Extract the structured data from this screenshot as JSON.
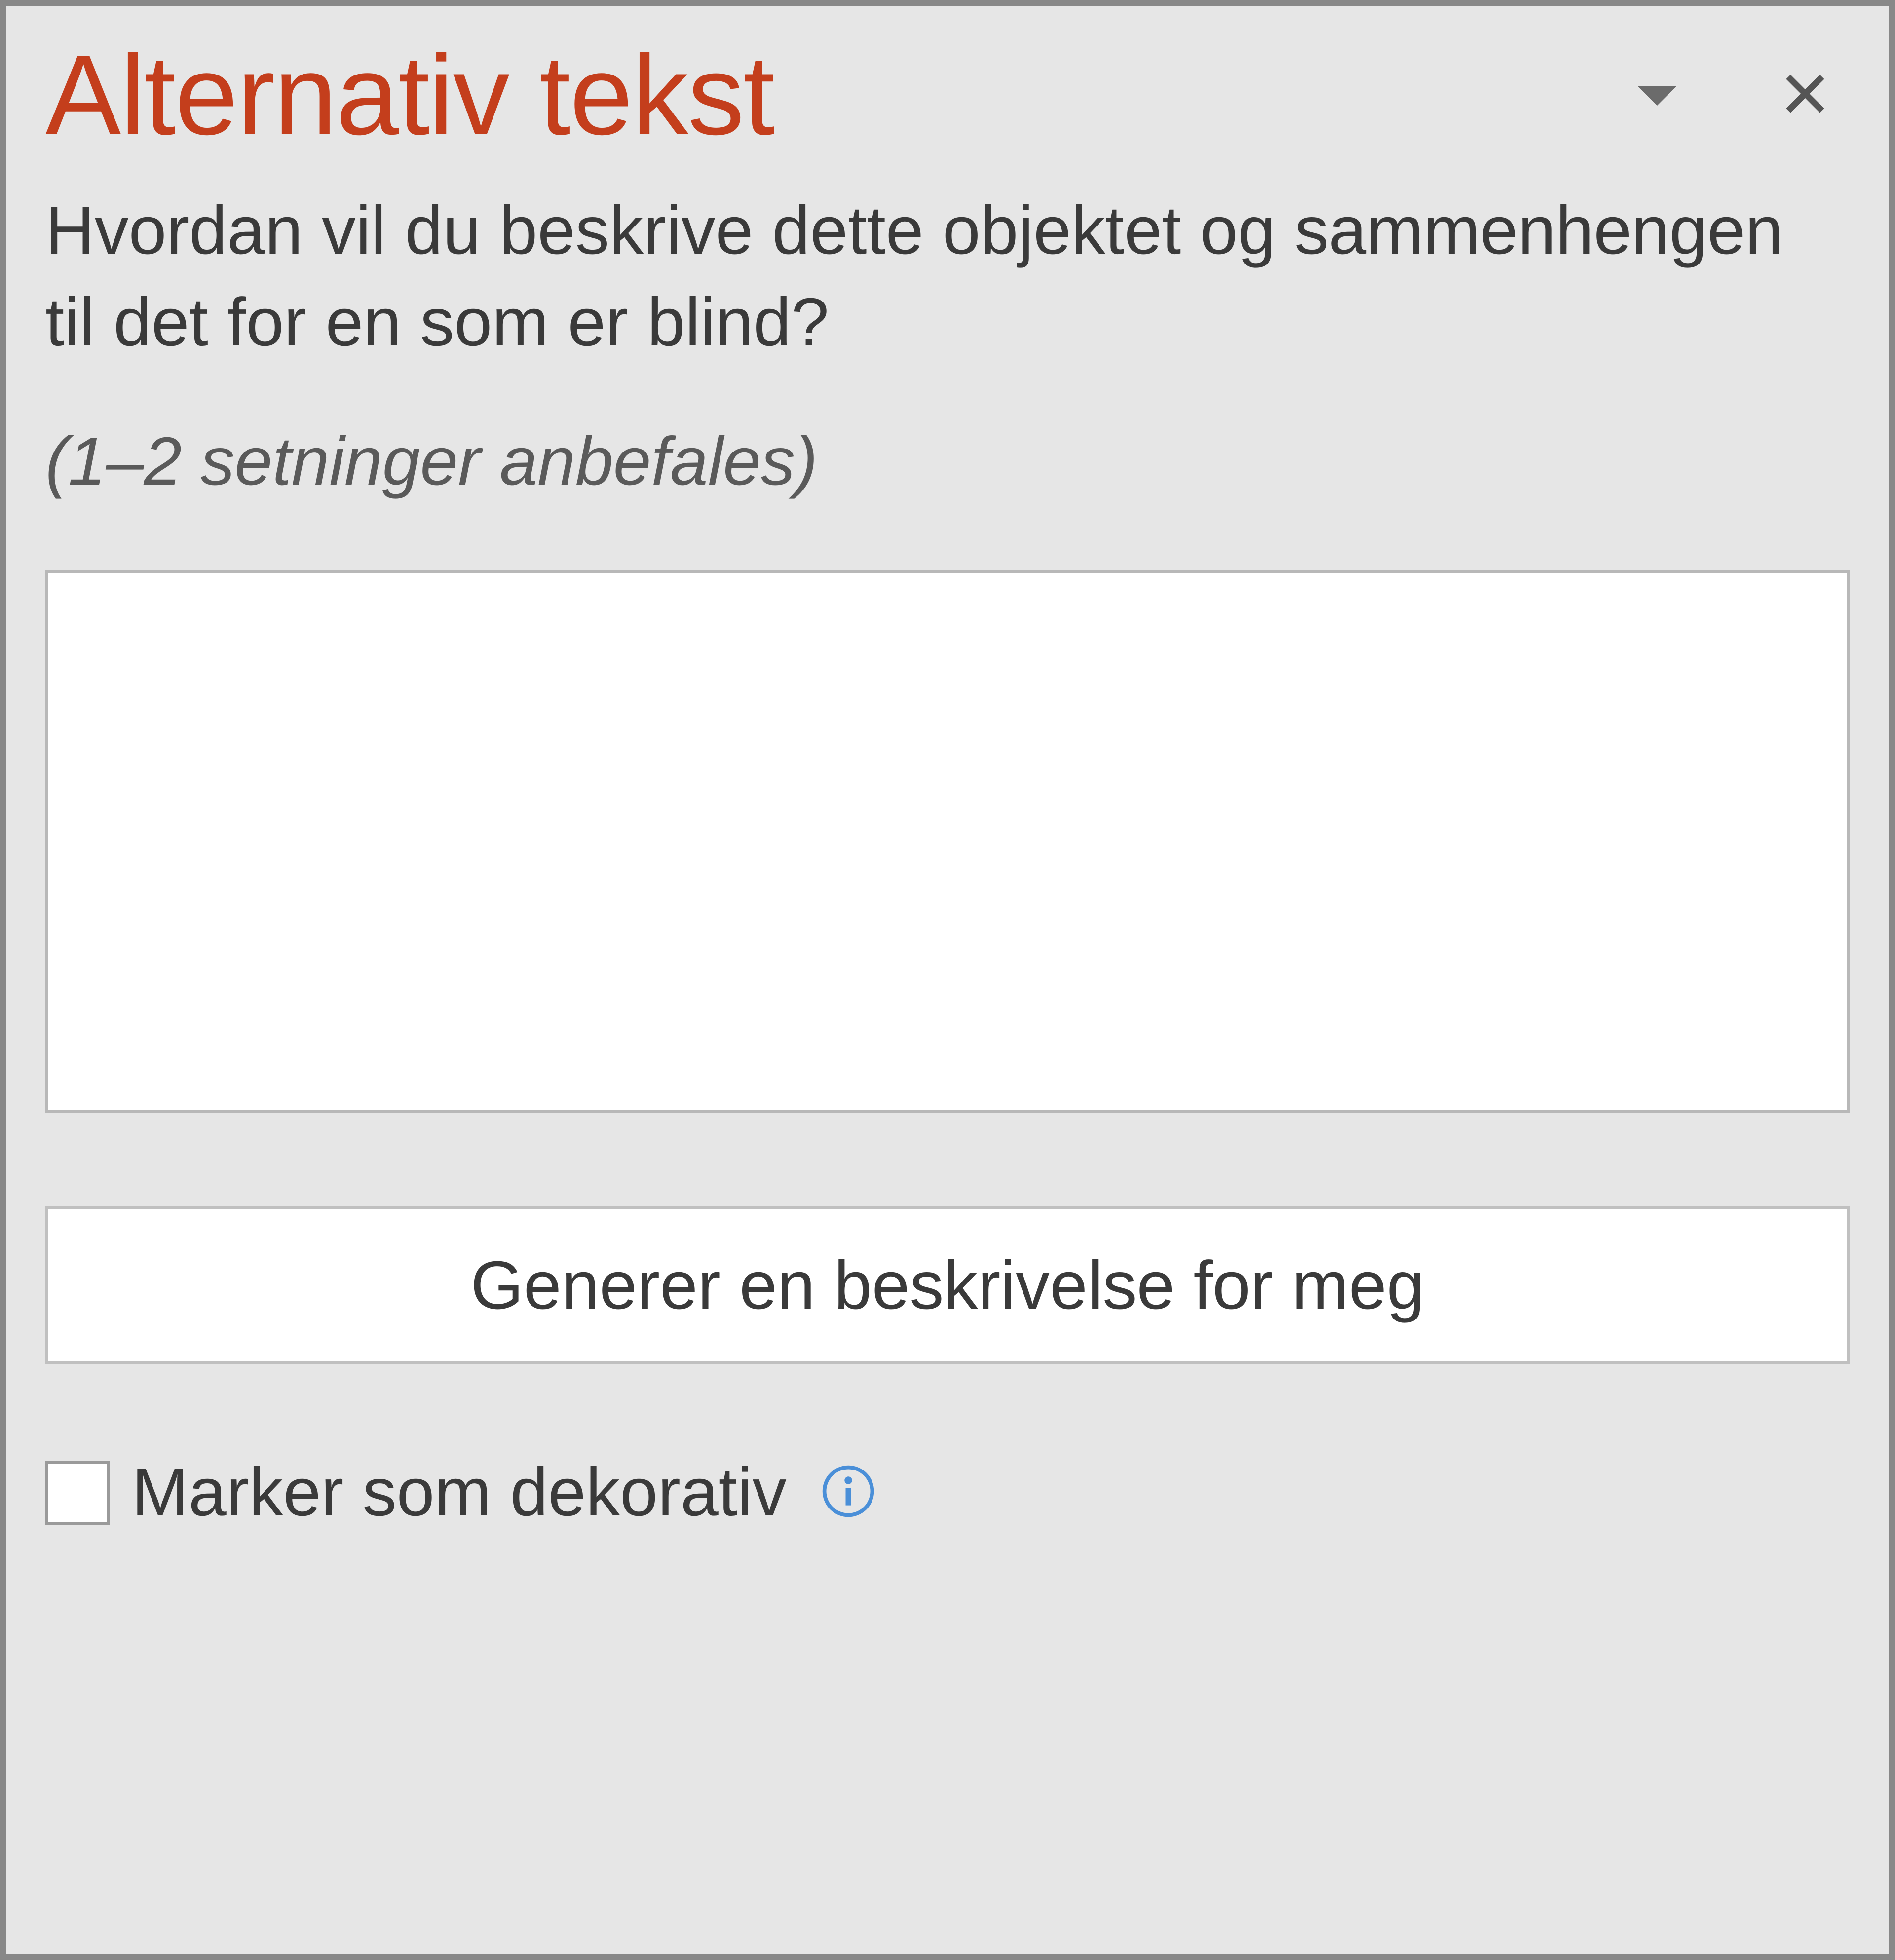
{
  "pane": {
    "title": "Alternativ tekst",
    "prompt": "Hvordan vil du beskrive dette objektet og sammenhengen til det for en som er blind?",
    "hint": "(1–2 setninger anbefales)",
    "textarea_value": "",
    "generate_button": "Generer en beskrivelse for meg",
    "decorative_checkbox_label": "Marker som dekorativ",
    "decorative_checked": false
  },
  "icons": {
    "dropdown": "chevron-down-icon",
    "close": "close-icon",
    "info": "info-icon"
  },
  "colors": {
    "accent": "#c43e1c",
    "panel_bg": "#e6e6e6",
    "border": "#888888",
    "text": "#3a3a3a",
    "info_blue": "#4a8fd8"
  }
}
